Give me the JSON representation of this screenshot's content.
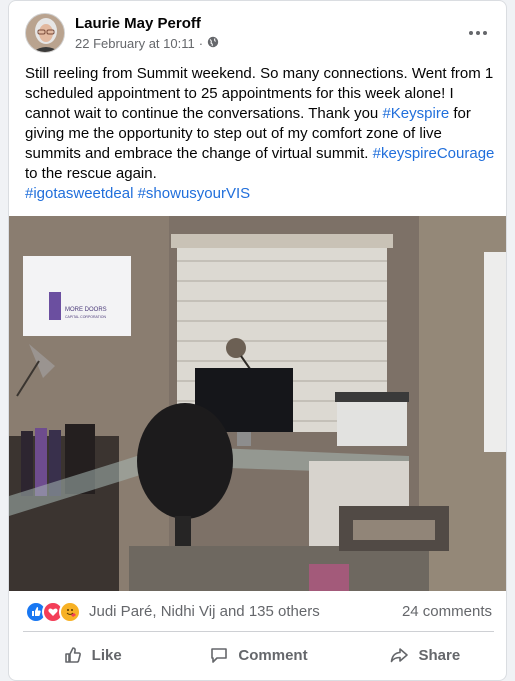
{
  "post": {
    "author": "Laurie May Peroff",
    "timestamp": "22 February at 10:11",
    "separator": "·",
    "audience_icon": "globe-icon",
    "more_icon": "more-options-icon",
    "text_1": "Still reeling from Summit weekend. So many connections. Went from 1 scheduled appointment to 25 appointments for this week alone! I cannot wait to continue the conversations. Thank you ",
    "hashtag_1": "#Keyspire",
    "text_2": " for giving me the opportunity to step out of my comfort zone of live summits and embrace the change of virtual summit. ",
    "hashtag_2": "#keyspireCourage",
    "text_3": " to the rescue again.",
    "hashtags_line": "#igotasweetdeal #showusyourVIS",
    "photo": {
      "sign_text_1": "MORE DOORS",
      "sign_text_2": "CAPITAL CORPORATION"
    }
  },
  "stats": {
    "reaction_icons": [
      "like-icon",
      "love-icon",
      "care-icon"
    ],
    "reactors": "Judi Paré, Nidhi Vij and 135 others",
    "comments": "24 comments"
  },
  "actions": {
    "like": "Like",
    "comment": "Comment",
    "share": "Share"
  },
  "colors": {
    "link": "#216fdb",
    "like_blue": "#1877f2",
    "love_red": "#f33e58",
    "care_yellow": "#f7b125",
    "secondary_text": "#65676b"
  }
}
